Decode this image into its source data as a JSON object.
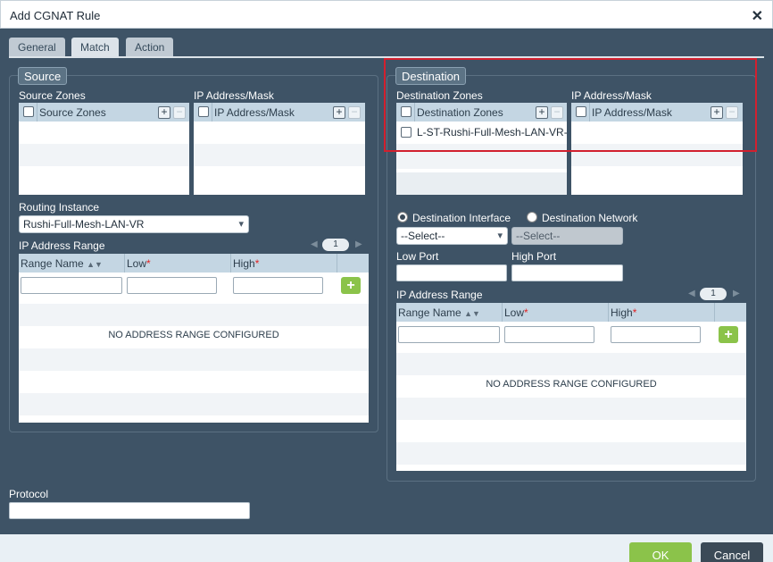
{
  "window": {
    "title": "Add CGNAT Rule"
  },
  "tabs": [
    {
      "label": "General"
    },
    {
      "label": "Match"
    },
    {
      "label": "Action"
    }
  ],
  "source": {
    "legend": "Source",
    "zones": {
      "label": "Source Zones",
      "header": "Source Zones"
    },
    "ipmask": {
      "label": "IP Address/Mask",
      "header": "IP Address/Mask"
    },
    "routing_instance": {
      "label": "Routing Instance",
      "value": "Rushi-Full-Mesh-LAN-VR"
    },
    "ip_range": {
      "label": "IP Address Range",
      "page": "1",
      "columns": [
        "Range Name",
        "Low",
        "High"
      ],
      "empty": "NO ADDRESS RANGE CONFIGURED"
    }
  },
  "destination": {
    "legend": "Destination",
    "zones": {
      "label": "Destination Zones",
      "header": "Destination Zones",
      "items": [
        "L-ST-Rushi-Full-Mesh-LAN-VR-I"
      ]
    },
    "ipmask": {
      "label": "IP Address/Mask",
      "header": "IP Address/Mask"
    },
    "radio_interface": "Destination Interface",
    "radio_network": "Destination Network",
    "select_interface": "--Select--",
    "select_network": "--Select--",
    "low_port": "Low Port",
    "high_port": "High Port",
    "ip_range": {
      "label": "IP Address Range",
      "page": "1",
      "columns": [
        "Range Name",
        "Low",
        "High"
      ],
      "empty": "NO ADDRESS RANGE CONFIGURED"
    }
  },
  "protocol": {
    "label": "Protocol"
  },
  "footer": {
    "ok": "OK",
    "cancel": "Cancel"
  },
  "icons": {
    "close": "close-icon",
    "add": "plus-icon",
    "remove": "minus-icon",
    "chevron": "chevron-down-icon",
    "sort": "sort-icon"
  },
  "colors": {
    "panel": "#3e5366",
    "accent_green": "#8bc34a",
    "highlight": "#d2202e",
    "grid_header": "#c4d6e3"
  }
}
